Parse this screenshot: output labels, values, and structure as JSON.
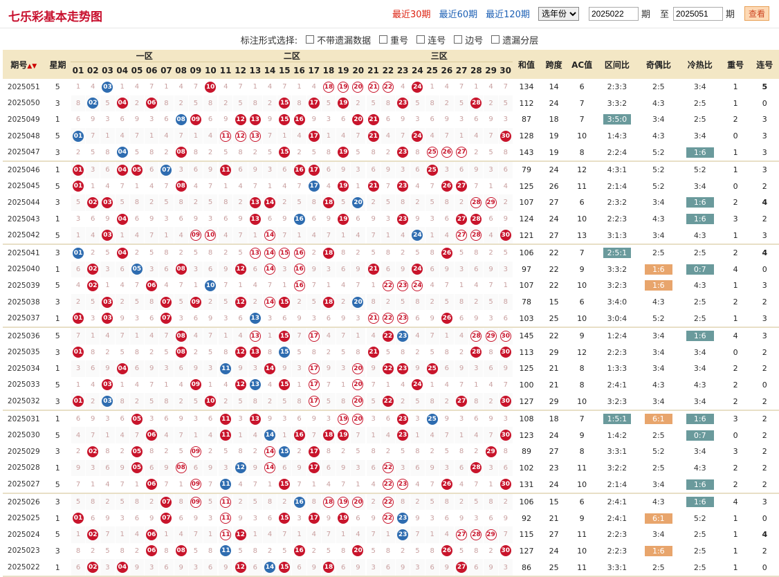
{
  "title": "七乐彩基本走势图",
  "nav": {
    "r30": "最近30期",
    "r60": "最近60期",
    "r120": "最近120期",
    "year_select": "选年份",
    "from": "2025022",
    "period_label": "期",
    "to_label": "至",
    "to": "2025051",
    "period_label2": "期",
    "check": "查看"
  },
  "filter": {
    "label": "标注形式选择:",
    "opts": [
      "不带遗漏数据",
      "重号",
      "连号",
      "边号",
      "遗漏分层"
    ]
  },
  "headers": {
    "issue": "期号",
    "week": "星期",
    "z1": "一区",
    "z2": "二区",
    "z3": "三区",
    "sum": "和值",
    "span": "跨度",
    "ac": "AC值",
    "zone_ratio": "区间比",
    "odd_even": "奇偶比",
    "hot_cold": "冷热比",
    "repeat": "重号",
    "consec": "连号",
    "nums": [
      "01",
      "02",
      "03",
      "04",
      "05",
      "06",
      "07",
      "08",
      "09",
      "10",
      "11",
      "12",
      "13",
      "14",
      "15",
      "16",
      "17",
      "18",
      "19",
      "20",
      "21",
      "22",
      "23",
      "24",
      "25",
      "26",
      "27",
      "28",
      "29",
      "30"
    ]
  },
  "rows": [
    {
      "issue": "2025051",
      "week": "5",
      "balls": [
        "03b",
        "10",
        "18r",
        "19r",
        "20r",
        "21r",
        "22r",
        "24"
      ],
      "sum": "134",
      "span": "14",
      "ac": "6",
      "zr": "2:3:3",
      "oe": "2:5",
      "hc": "3:4",
      "rep": "1",
      "con": "5",
      "conc": "green"
    },
    {
      "issue": "2025050",
      "week": "3",
      "balls": [
        "02b",
        "04",
        "06",
        "15",
        "17",
        "19",
        "23",
        "28"
      ],
      "sum": "112",
      "span": "24",
      "ac": "7",
      "zr": "3:3:2",
      "oe": "4:3",
      "hc": "2:5",
      "rep": "1",
      "con": "0"
    },
    {
      "issue": "2025049",
      "week": "1",
      "balls": [
        "08b",
        "09",
        "12",
        "13",
        "15",
        "16",
        "20",
        "21"
      ],
      "sum": "87",
      "span": "18",
      "ac": "7",
      "zr": "3:5:0",
      "zrp": "gray",
      "oe": "3:4",
      "hc": "2:5",
      "rep": "2",
      "con": "3"
    },
    {
      "issue": "2025048",
      "week": "5",
      "balls": [
        "01b",
        "11r",
        "12r",
        "13r",
        "17",
        "21",
        "24",
        "30"
      ],
      "sum": "128",
      "span": "19",
      "ac": "10",
      "zr": "1:4:3",
      "oe": "4:3",
      "hc": "3:4",
      "rep": "0",
      "con": "3"
    },
    {
      "issue": "2025047",
      "week": "3",
      "balls": [
        "04b",
        "08",
        "15",
        "19",
        "23",
        "25r",
        "26r",
        "27r"
      ],
      "sum": "143",
      "span": "19",
      "ac": "8",
      "zr": "2:2:4",
      "oe": "5:2",
      "hc": "1:6",
      "hcp": "gray",
      "rep": "1",
      "con": "3",
      "end": true
    },
    {
      "issue": "2025046",
      "week": "1",
      "balls": [
        "01",
        "04",
        "05",
        "07b",
        "11",
        "16",
        "17",
        "25"
      ],
      "sum": "79",
      "span": "24",
      "ac": "12",
      "zr": "4:3:1",
      "oe": "5:2",
      "hc": "5:2",
      "rep": "1",
      "con": "3"
    },
    {
      "issue": "2025045",
      "week": "5",
      "balls": [
        "01",
        "08",
        "17b",
        "19",
        "21",
        "23",
        "26",
        "27"
      ],
      "sum": "125",
      "span": "26",
      "ac": "11",
      "zr": "2:1:4",
      "oe": "5:2",
      "hc": "3:4",
      "rep": "0",
      "con": "2"
    },
    {
      "issue": "2025044",
      "week": "3",
      "balls": [
        "02",
        "03",
        "13",
        "14",
        "18",
        "20b",
        "28r",
        "29r"
      ],
      "sum": "107",
      "span": "27",
      "ac": "6",
      "zr": "2:3:2",
      "oe": "3:4",
      "hc": "1:6",
      "hcp": "gray",
      "rep": "2",
      "con": "4",
      "conc": "green"
    },
    {
      "issue": "2025043",
      "week": "1",
      "balls": [
        "04",
        "13",
        "16b",
        "19",
        "23",
        "27",
        "28"
      ],
      "sum": "124",
      "span": "24",
      "ac": "10",
      "zr": "2:2:3",
      "oe": "4:3",
      "hc": "1:6",
      "hcp": "gray",
      "rep": "3",
      "con": "2"
    },
    {
      "issue": "2025042",
      "week": "5",
      "balls": [
        "03",
        "09r",
        "10r",
        "14r",
        "24b",
        "27r",
        "28r",
        "30"
      ],
      "sum": "121",
      "span": "27",
      "ac": "13",
      "zr": "3:1:3",
      "oe": "3:4",
      "hc": "4:3",
      "rep": "1",
      "con": "3",
      "end": true
    },
    {
      "issue": "2025041",
      "week": "3",
      "balls": [
        "01b",
        "04",
        "13r",
        "14r",
        "15r",
        "16r",
        "18",
        "26"
      ],
      "sum": "106",
      "span": "22",
      "ac": "7",
      "zr": "2:5:1",
      "zrp": "gray",
      "oe": "2:5",
      "hc": "2:5",
      "rep": "2",
      "con": "4",
      "conc": "green"
    },
    {
      "issue": "2025040",
      "week": "1",
      "balls": [
        "02",
        "05b",
        "08",
        "12",
        "14r",
        "16r",
        "21",
        "24"
      ],
      "sum": "97",
      "span": "22",
      "ac": "9",
      "zr": "3:3:2",
      "oe": "1:6",
      "oep": "orange",
      "hc": "0:7",
      "hcp": "gray",
      "rep": "4",
      "repc": "hot",
      "con": "0"
    },
    {
      "issue": "2025039",
      "week": "5",
      "balls": [
        "02",
        "06",
        "10b",
        "16r",
        "22r",
        "23r",
        "24r"
      ],
      "sum": "107",
      "span": "22",
      "ac": "10",
      "zr": "3:2:3",
      "oe": "1:6",
      "oep": "orange",
      "hc": "4:3",
      "rep": "1",
      "con": "3"
    },
    {
      "issue": "2025038",
      "week": "3",
      "balls": [
        "03",
        "07",
        "09",
        "12",
        "14r",
        "15",
        "18",
        "20b"
      ],
      "sum": "78",
      "span": "15",
      "ac": "6",
      "zr": "3:4:0",
      "oe": "4:3",
      "hc": "2:5",
      "rep": "2",
      "con": "2"
    },
    {
      "issue": "2025037",
      "week": "1",
      "balls": [
        "01",
        "03",
        "07",
        "13b",
        "21r",
        "22r",
        "23r",
        "26"
      ],
      "sum": "103",
      "span": "25",
      "ac": "10",
      "zr": "3:0:4",
      "oe": "5:2",
      "hc": "2:5",
      "rep": "1",
      "con": "3",
      "end": true
    },
    {
      "issue": "2025036",
      "week": "5",
      "balls": [
        "08",
        "13r",
        "15",
        "17r",
        "22",
        "23b",
        "28r",
        "29r",
        "30r"
      ],
      "sum": "145",
      "span": "22",
      "ac": "9",
      "zr": "1:2:4",
      "oe": "3:4",
      "hc": "1:6",
      "hcp": "gray",
      "rep": "4",
      "repc": "hot",
      "con": "3"
    },
    {
      "issue": "2025035",
      "week": "3",
      "balls": [
        "01",
        "08",
        "12",
        "13",
        "15b",
        "21",
        "28",
        "30"
      ],
      "sum": "113",
      "span": "29",
      "ac": "12",
      "zr": "2:2:3",
      "oe": "3:4",
      "hc": "3:4",
      "rep": "0",
      "con": "2"
    },
    {
      "issue": "2025034",
      "week": "1",
      "balls": [
        "04",
        "11b",
        "14",
        "17r",
        "20r",
        "22",
        "23",
        "25"
      ],
      "sum": "125",
      "span": "21",
      "ac": "8",
      "zr": "1:3:3",
      "oe": "3:4",
      "hc": "3:4",
      "rep": "2",
      "con": "2"
    },
    {
      "issue": "2025033",
      "week": "5",
      "balls": [
        "03",
        "09",
        "12",
        "13b",
        "15",
        "17r",
        "20r",
        "24"
      ],
      "sum": "100",
      "span": "21",
      "ac": "8",
      "zr": "2:4:1",
      "oe": "4:3",
      "hc": "4:3",
      "rep": "2",
      "con": "0"
    },
    {
      "issue": "2025032",
      "week": "3",
      "balls": [
        "01",
        "03b",
        "10",
        "17r",
        "20r",
        "22",
        "27",
        "30"
      ],
      "sum": "127",
      "span": "29",
      "ac": "10",
      "zr": "3:2:3",
      "oe": "3:4",
      "hc": "3:4",
      "rep": "2",
      "con": "2",
      "end": true
    },
    {
      "issue": "2025031",
      "week": "1",
      "balls": [
        "05",
        "11",
        "13",
        "19r",
        "20r",
        "23",
        "25b"
      ],
      "sum": "108",
      "span": "18",
      "ac": "7",
      "zr": "1:5:1",
      "zrp": "gray",
      "oe": "6:1",
      "oep": "orange",
      "hc": "1:6",
      "hcp": "gray",
      "rep": "3",
      "con": "2"
    },
    {
      "issue": "2025030",
      "week": "5",
      "balls": [
        "06",
        "11",
        "14b",
        "16",
        "18",
        "19",
        "23",
        "30"
      ],
      "sum": "123",
      "span": "24",
      "ac": "9",
      "zr": "1:4:2",
      "oe": "2:5",
      "hc": "0:7",
      "hcp": "gray",
      "rep": "0",
      "con": "2"
    },
    {
      "issue": "2025029",
      "week": "3",
      "balls": [
        "02",
        "05",
        "09r",
        "14r",
        "15b",
        "17",
        "29"
      ],
      "sum": "89",
      "span": "27",
      "ac": "8",
      "zr": "3:3:1",
      "oe": "5:2",
      "hc": "3:4",
      "rep": "3",
      "con": "2"
    },
    {
      "issue": "2025028",
      "week": "1",
      "balls": [
        "05",
        "08r",
        "12b",
        "14r",
        "17",
        "22r",
        "28"
      ],
      "sum": "102",
      "span": "23",
      "ac": "11",
      "zr": "3:2:2",
      "oe": "2:5",
      "hc": "4:3",
      "rep": "2",
      "con": "2"
    },
    {
      "issue": "2025027",
      "week": "5",
      "balls": [
        "06",
        "09r",
        "11b",
        "15",
        "22r",
        "23r",
        "26",
        "30"
      ],
      "sum": "131",
      "span": "24",
      "ac": "10",
      "zr": "2:1:4",
      "oe": "3:4",
      "hc": "1:6",
      "hcp": "gray",
      "rep": "2",
      "con": "2",
      "end": true
    },
    {
      "issue": "2025026",
      "week": "3",
      "balls": [
        "07",
        "09r",
        "11r",
        "16b",
        "18r",
        "19r",
        "20r",
        "22r"
      ],
      "sum": "106",
      "span": "15",
      "ac": "6",
      "zr": "2:4:1",
      "oe": "4:3",
      "hc": "1:6",
      "hcp": "gray",
      "rep": "4",
      "repc": "hot",
      "con": "3"
    },
    {
      "issue": "2025025",
      "week": "1",
      "balls": [
        "01",
        "07",
        "11r",
        "15",
        "17",
        "19",
        "22r",
        "23b"
      ],
      "sum": "92",
      "span": "21",
      "ac": "9",
      "zr": "2:4:1",
      "oe": "6:1",
      "oep": "orange",
      "hc": "5:2",
      "rep": "1",
      "con": "0"
    },
    {
      "issue": "2025024",
      "week": "5",
      "balls": [
        "02",
        "06",
        "11r",
        "12",
        "23b",
        "27r",
        "28r",
        "29r"
      ],
      "sum": "115",
      "span": "27",
      "ac": "11",
      "zr": "2:2:3",
      "oe": "3:4",
      "hc": "2:5",
      "rep": "1",
      "con": "4",
      "conc": "green"
    },
    {
      "issue": "2025023",
      "week": "3",
      "balls": [
        "06",
        "08",
        "11b",
        "16",
        "20",
        "26",
        "30"
      ],
      "sum": "127",
      "span": "24",
      "ac": "10",
      "zr": "2:2:3",
      "oe": "1:6",
      "oep": "orange",
      "hc": "2:5",
      "rep": "1",
      "con": "2"
    },
    {
      "issue": "2025022",
      "week": "1",
      "balls": [
        "02",
        "04",
        "12",
        "14b",
        "15",
        "18",
        "27"
      ],
      "sum": "86",
      "span": "25",
      "ac": "11",
      "zr": "3:3:1",
      "oe": "2:5",
      "hc": "2:5",
      "rep": "1",
      "con": "0",
      "end": true
    }
  ]
}
